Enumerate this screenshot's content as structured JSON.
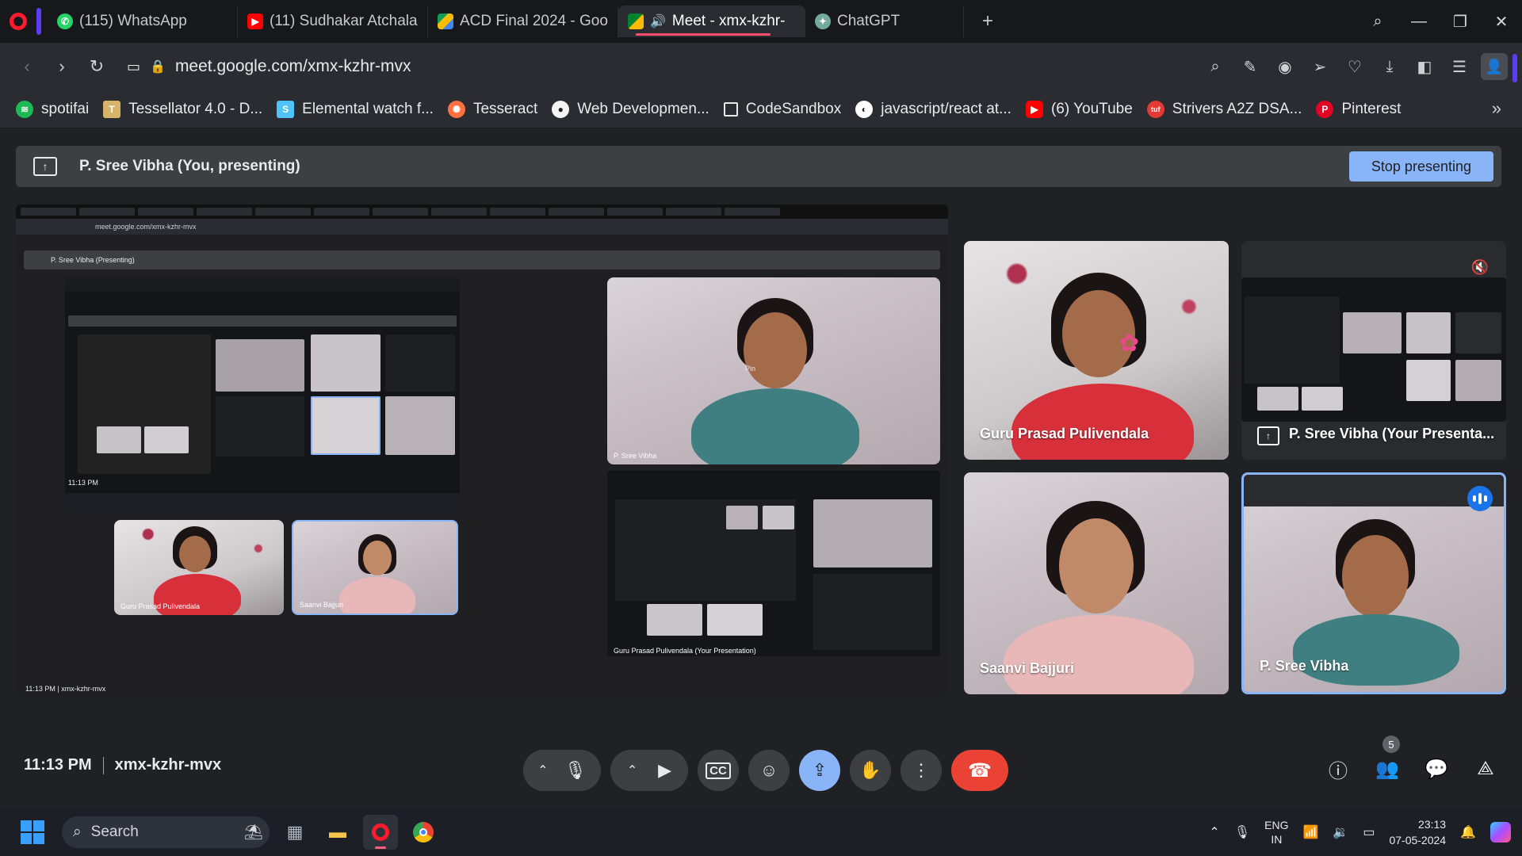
{
  "browser": {
    "tabs": [
      {
        "title": "(115) WhatsApp",
        "icon": "whatsapp-icon",
        "active": false
      },
      {
        "title": "(11) Sudhakar Atchala -",
        "icon": "youtube-icon",
        "active": false
      },
      {
        "title": "ACD Final 2024 - Google",
        "icon": "google-drive-icon",
        "active": false
      },
      {
        "title": "Meet - xmx-kzhr-",
        "icon": "google-meet-icon",
        "active": true
      },
      {
        "title": "ChatGPT",
        "icon": "chatgpt-icon",
        "active": false
      }
    ],
    "url": "meet.google.com/xmx-kzhr-mvx",
    "bookmarks": [
      {
        "label": "spotifai",
        "icon": "spotify-icon",
        "color": "#1db954"
      },
      {
        "label": "Tessellator 4.0 - D...",
        "icon": "tessellator-icon",
        "color": "#d6b46a"
      },
      {
        "label": "Elemental watch f...",
        "icon": "elemental-icon",
        "color": "#4fc3f7"
      },
      {
        "label": "Tesseract",
        "icon": "tesseract-icon",
        "color": "#ff7043"
      },
      {
        "label": "Web Developmen...",
        "icon": "web-dev-icon",
        "color": "#f5f5f5"
      },
      {
        "label": "CodeSandbox",
        "icon": "codesandbox-icon",
        "color": "#2b2c31"
      },
      {
        "label": "javascript/react at...",
        "icon": "github-icon",
        "color": "#ffffff"
      },
      {
        "label": "(6) YouTube",
        "icon": "youtube-icon",
        "color": "#ff0000"
      },
      {
        "label": "Strivers A2Z DSA...",
        "icon": "tuf-icon",
        "color": "#e53935"
      },
      {
        "label": "Pinterest",
        "icon": "pinterest-icon",
        "color": "#e60023"
      }
    ]
  },
  "meet": {
    "banner_text": "P. Sree Vibha (You, presenting)",
    "stop_presenting": "Stop presenting",
    "nested": {
      "banner_text": "P. Sree Vibha (Presenting)",
      "tile_names": [
        "P. Sree Vibha",
        "Guru Prasad Pulivendala",
        "Saanvi Bajjuri",
        "Guru Prasad Pulivendala (Your Presentation)"
      ],
      "pin_tooltip": "Pin",
      "time": "11:13 PM",
      "code": "xmx-kzhr-mvx"
    },
    "participants": [
      {
        "name": "Guru Prasad Pulivendala"
      },
      {
        "name": "P. Sree Vibha (Your Presenta..."
      },
      {
        "name": "Saanvi Bajjuri"
      },
      {
        "name": "P. Sree Vibha"
      }
    ],
    "time": "11:13 PM",
    "meeting_code": "xmx-kzhr-mvx",
    "people_count": "5",
    "accent_blue": "#8ab4f8",
    "end_call_red": "#ea4335"
  },
  "taskbar": {
    "search_placeholder": "Search",
    "lang_line1": "ENG",
    "lang_line2": "IN",
    "time": "23:13",
    "date": "07-05-2024"
  }
}
